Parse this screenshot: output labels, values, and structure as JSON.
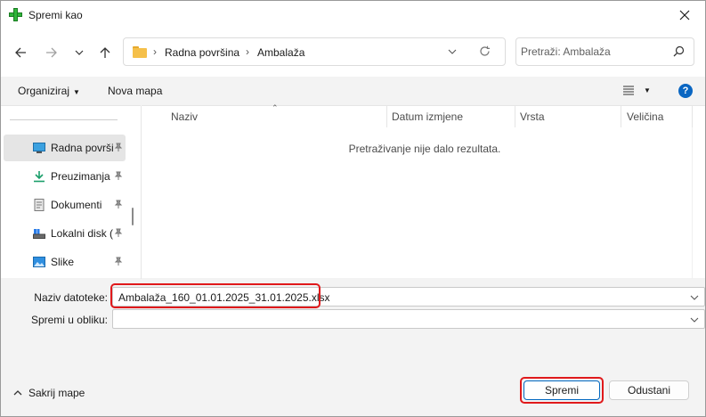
{
  "window": {
    "title": "Spremi kao",
    "icons": {
      "app": "green-plus-icon",
      "close": "close-icon"
    }
  },
  "nav": {
    "breadcrumb": [
      "Radna površina",
      "Ambalaža"
    ],
    "search_placeholder": "Pretraži: Ambalaža"
  },
  "toolbar": {
    "organize_label": "Organiziraj",
    "new_folder_label": "Nova mapa",
    "help_label": "?"
  },
  "sidebar": {
    "items": [
      {
        "label": "Radna površi",
        "icon": "desktop-icon",
        "selected": true
      },
      {
        "label": "Preuzimanja",
        "icon": "download-icon",
        "selected": false
      },
      {
        "label": "Dokumenti",
        "icon": "document-icon",
        "selected": false
      },
      {
        "label": "Lokalni disk (",
        "icon": "drive-icon",
        "selected": false
      },
      {
        "label": "Slike",
        "icon": "pictures-icon",
        "selected": false
      }
    ]
  },
  "filelist": {
    "columns": [
      "Naziv",
      "Datum izmjene",
      "Vrsta",
      "Veličina"
    ],
    "empty_message": "Pretraživanje nije dalo rezultata."
  },
  "form": {
    "filename_label": "Naziv datoteke:",
    "filename_value": "Ambalaža_160_01.01.2025_31.01.2025.xlsx",
    "filetype_label": "Spremi u obliku:",
    "filetype_value": ""
  },
  "footer": {
    "hide_folders_label": "Sakrij mape",
    "save_label": "Spremi",
    "cancel_label": "Odustani"
  },
  "colors": {
    "accent": "#0067c0",
    "highlight": "#e0191b"
  }
}
